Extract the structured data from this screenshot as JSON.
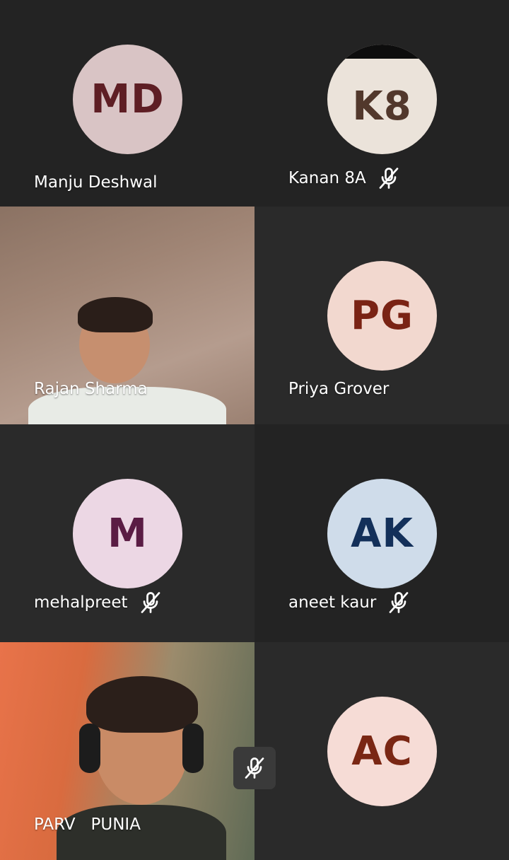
{
  "participants": [
    {
      "name": "Manju Deshwal",
      "initials": "MD",
      "avatar_bg": "#d9c4c5",
      "initials_color": "#5e1e24",
      "muted": false,
      "video": false
    },
    {
      "name": "Kanan 8A",
      "initials": "K8",
      "avatar_bg": "#ebe3da",
      "initials_color": "#52382c",
      "muted": true,
      "video": false
    },
    {
      "name": "Rajan Sharma",
      "initials": "",
      "muted": false,
      "video": true
    },
    {
      "name": "Priya Grover",
      "initials": "PG",
      "avatar_bg": "#f2d8cf",
      "initials_color": "#7a2314",
      "muted": false,
      "video": false
    },
    {
      "name": "mehalpreet",
      "initials": "M",
      "avatar_bg": "#ecd7e4",
      "initials_color": "#5a1c44",
      "muted": true,
      "video": false
    },
    {
      "name": "aneet kaur",
      "initials": "AK",
      "avatar_bg": "#cfdcea",
      "initials_color": "#13305a",
      "muted": true,
      "video": false
    },
    {
      "name": "PARV   PUNIA",
      "initials": "",
      "muted": true,
      "video": true
    },
    {
      "name": "",
      "initials": "AC",
      "avatar_bg": "#f6dcd6",
      "initials_color": "#7a2714",
      "muted": false,
      "video": false
    }
  ],
  "icons": {
    "mic_off": "mic-off-icon"
  }
}
